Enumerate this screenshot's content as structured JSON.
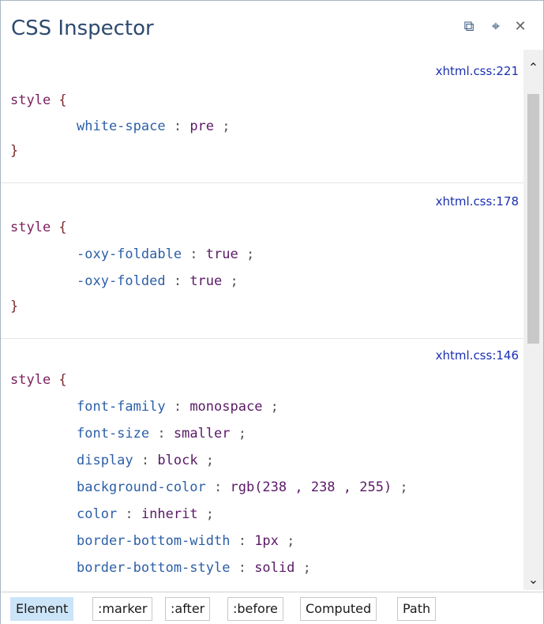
{
  "panel": {
    "title": "CSS Inspector",
    "buttons": {
      "restore": "⧉",
      "pin": "⌖",
      "close": "✕"
    }
  },
  "rules": [
    {
      "source": "xhtml.css:221",
      "selector": "style",
      "declarations": [
        {
          "property": "white-space",
          "value": "pre"
        }
      ]
    },
    {
      "source": "xhtml.css:178",
      "selector": "style",
      "declarations": [
        {
          "property": "-oxy-foldable",
          "value": "true"
        },
        {
          "property": "-oxy-folded",
          "value": "true"
        }
      ]
    },
    {
      "source": "xhtml.css:146",
      "selector": "style",
      "declarations": [
        {
          "property": "font-family",
          "value": "monospace"
        },
        {
          "property": "font-size",
          "value": "smaller"
        },
        {
          "property": "display",
          "value": "block"
        },
        {
          "property": "background-color",
          "value": "rgb(238 , 238 , 255)"
        },
        {
          "property": "color",
          "value": "inherit"
        },
        {
          "property": "border-bottom-width",
          "value": "1px"
        },
        {
          "property": "border-bottom-style",
          "value": "solid"
        }
      ]
    }
  ],
  "tabs": [
    {
      "label": "Element",
      "active": true
    },
    {
      "label": ":marker",
      "active": false
    },
    {
      "label": ":after",
      "active": false
    },
    {
      "label": ":before",
      "active": false
    },
    {
      "label": "Computed",
      "active": false
    },
    {
      "label": "Path",
      "active": false
    }
  ],
  "scroll": {
    "up": "⌃",
    "down": "⌄"
  }
}
